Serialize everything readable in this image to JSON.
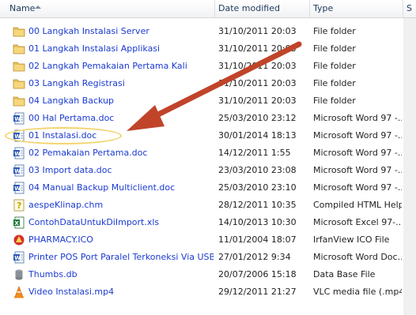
{
  "columns": {
    "name": "Name",
    "date": "Date modified",
    "type": "Type",
    "size": "S"
  },
  "files": [
    {
      "name": "00 Langkah Instalasi Server",
      "date": "31/10/2011 20:03",
      "type": "File folder",
      "icon": "folder-icon"
    },
    {
      "name": "01 Langkah Instalasi Applikasi",
      "date": "31/10/2011 20:03",
      "type": "File folder",
      "icon": "folder-icon"
    },
    {
      "name": "02 Langkah Pemakaian Pertama Kali",
      "date": "31/10/2011 20:03",
      "type": "File folder",
      "icon": "folder-icon"
    },
    {
      "name": "03 Langkah Registrasi",
      "date": "31/10/2011 20:03",
      "type": "File folder",
      "icon": "folder-icon"
    },
    {
      "name": "04 Langkah Backup",
      "date": "31/10/2011 20:03",
      "type": "File folder",
      "icon": "folder-icon"
    },
    {
      "name": "00 Hal Pertama.doc",
      "date": "25/03/2010 23:12",
      "type": "Microsoft Word 97 -...",
      "icon": "word-doc-icon"
    },
    {
      "name": "01 Instalasi.doc",
      "date": "30/01/2014 18:13",
      "type": "Microsoft Word 97 -...",
      "icon": "word-doc-icon"
    },
    {
      "name": "02 Pemakaian Pertama.doc",
      "date": "14/12/2011 1:55",
      "type": "Microsoft Word 97 -...",
      "icon": "word-doc-icon"
    },
    {
      "name": "03 Import data.doc",
      "date": "23/03/2010 23:08",
      "type": "Microsoft Word 97 -...",
      "icon": "word-doc-icon"
    },
    {
      "name": "04 Manual Backup Multiclient.doc",
      "date": "25/03/2010 23:10",
      "type": "Microsoft Word 97 -...",
      "icon": "word-doc-icon"
    },
    {
      "name": "aespeKlinap.chm",
      "date": "28/12/2011 10:35",
      "type": "Compiled HTML Help...",
      "icon": "chm-help-icon"
    },
    {
      "name": "ContohDataUntukDiImport.xls",
      "date": "14/10/2013 10:30",
      "type": "Microsoft Excel 97-...",
      "icon": "excel-icon"
    },
    {
      "name": "PHARMACY.ICO",
      "date": "11/01/2004 18:07",
      "type": "IrfanView ICO File",
      "icon": "irfanview-icon"
    },
    {
      "name": "Printer POS Port Paralel Terkoneksi Via USB.d...",
      "date": "27/01/2012 9:34",
      "type": "Microsoft Word Doc...",
      "icon": "word-doc-icon"
    },
    {
      "name": "Thumbs.db",
      "date": "20/07/2006 15:18",
      "type": "Data Base File",
      "icon": "database-icon"
    },
    {
      "name": "Video Instalasi.mp4",
      "date": "29/12/2011 21:27",
      "type": "VLC media file (.mp4)",
      "icon": "vlc-icon"
    }
  ],
  "colors": {
    "link": "#1a3ad0",
    "arrow": "#c0442a",
    "highlight": "#f3d36b"
  }
}
